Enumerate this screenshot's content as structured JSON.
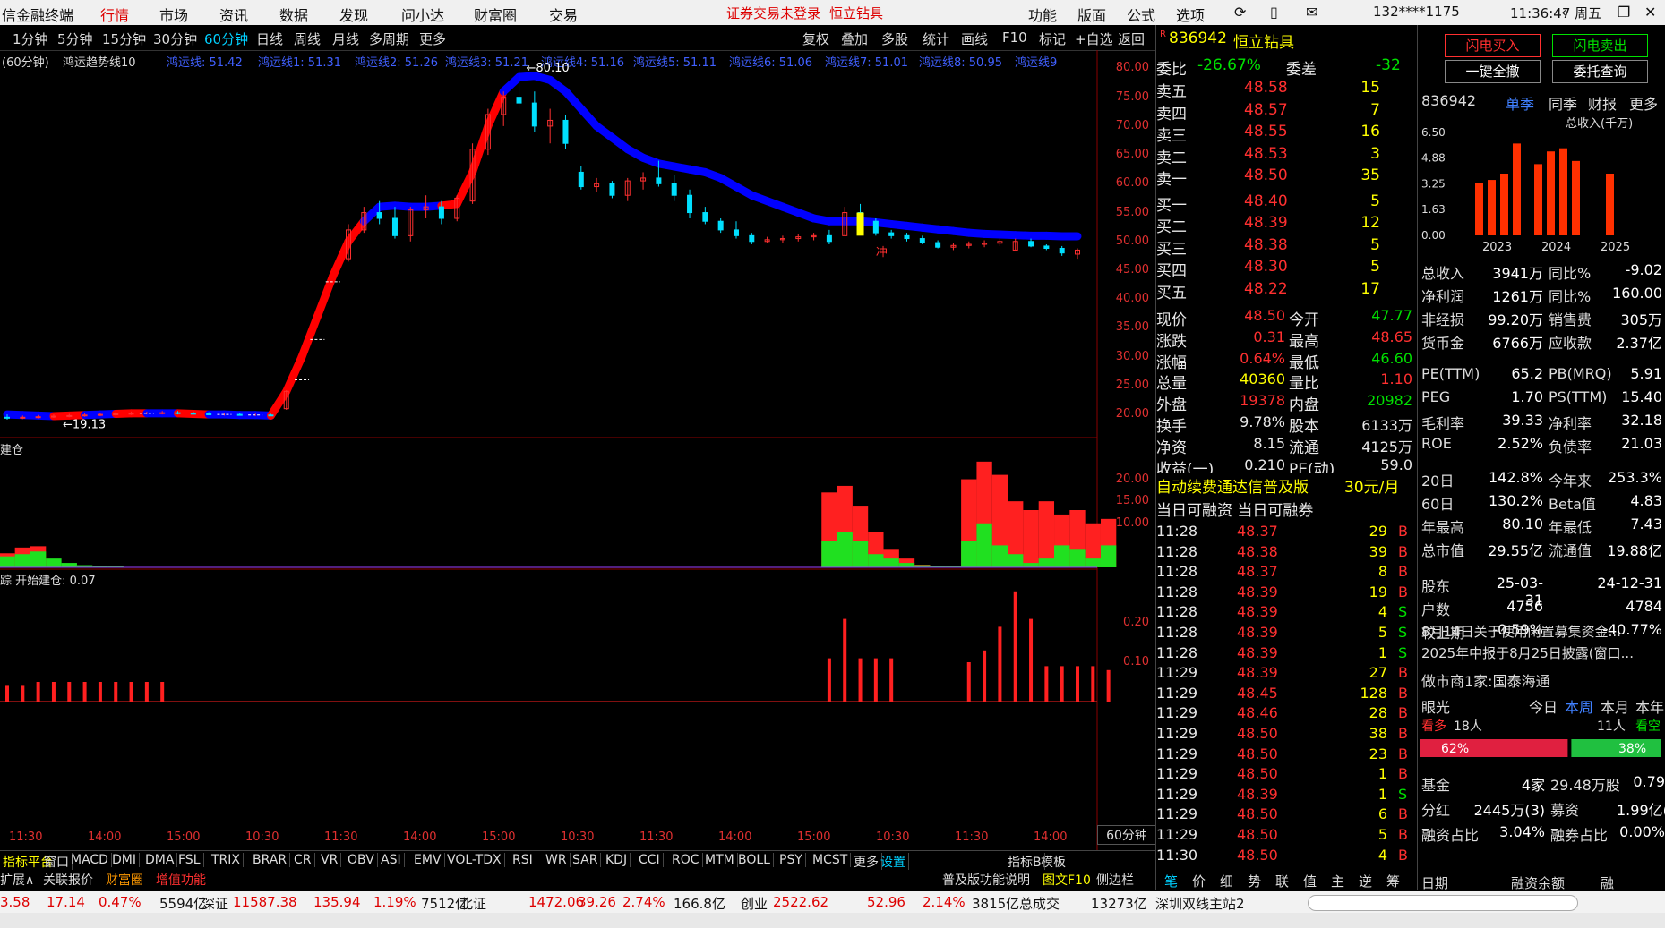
{
  "menubar": {
    "app": "信金融终端",
    "items": [
      "行情",
      "市场",
      "资讯",
      "数据",
      "发现",
      "问小达",
      "财富圈",
      "交易"
    ],
    "notice": "证券交易未登录",
    "stock_name": "恒立钻具",
    "right": [
      "功能",
      "版面",
      "公式",
      "选项"
    ],
    "account": "132****1175",
    "clock": "11:36:47 周五"
  },
  "timeframes": [
    "1分钟",
    "5分钟",
    "15分钟",
    "30分钟",
    "60分钟",
    "日线",
    "周线",
    "月线",
    "多周期",
    "更多"
  ],
  "toolbar": [
    "复权",
    "叠加",
    "多股",
    "统计",
    "画线",
    "F10",
    "标记",
    "+自选",
    "返回"
  ],
  "indicator_header": {
    "period": "(60分钟)",
    "name": "鸿运趋势线10",
    "lines": [
      "鸿运线: 51.42",
      "鸿运线1: 51.31",
      "鸿运线2: 51.26",
      "鸿运线3: 51.21",
      "鸿运线4: 51.16",
      "鸿运线5: 51.11",
      "鸿运线6: 51.06",
      "鸿运线7: 51.01",
      "鸿运线8: 50.95",
      "鸿运线9"
    ]
  },
  "price_axis": [
    "80.00",
    "75.00",
    "70.00",
    "65.00",
    "60.00",
    "55.00",
    "50.00",
    "45.00",
    "40.00",
    "35.00",
    "30.00",
    "25.00",
    "20.00"
  ],
  "price_markers": {
    "high": "80.10",
    "low": "19.13",
    "label": "冲"
  },
  "panel2": {
    "label": "建仓",
    "axis": [
      "20.00",
      "15.00",
      "10.00"
    ]
  },
  "panel3": {
    "label": "踪",
    "extra": "开始建仓: 0.07",
    "axis": [
      "0.20",
      "0.10"
    ]
  },
  "time_axis": [
    "11:30",
    "14:00",
    "15:00",
    "10:30",
    "11:30",
    "14:00",
    "15:00",
    "10:30",
    "11:30",
    "14:00",
    "15:00",
    "10:30",
    "11:30",
    "14:00"
  ],
  "period_badge": "60分钟",
  "indicator_tabs": [
    "指标平台",
    "窗口",
    "MACD",
    "DMI",
    "DMA",
    "FSL",
    "TRIX",
    "BRAR",
    "CR",
    "VR",
    "OBV",
    "ASI",
    "EMV",
    "VOL-TDX",
    "RSI",
    "WR",
    "SAR",
    "KDJ",
    "CCI",
    "ROC",
    "MTM",
    "BOLL",
    "PSY",
    "MCST",
    "更多",
    "设置",
    "指标B",
    "模板"
  ],
  "bottom_tabs": [
    "扩展∧",
    "关联报价",
    "财富圈",
    "增值功能"
  ],
  "bottom_links": [
    "普及版功能说明",
    "图文F10",
    "侧边栏"
  ],
  "quote": {
    "code": "836942",
    "name": "恒立钻具",
    "wb_label": "委比",
    "wb": "-26.67%",
    "wc_label": "委差",
    "wc": "-32",
    "asks": [
      [
        "卖五",
        "48.58",
        "15"
      ],
      [
        "卖四",
        "48.57",
        "7"
      ],
      [
        "卖三",
        "48.55",
        "16"
      ],
      [
        "卖二",
        "48.53",
        "3"
      ],
      [
        "卖一",
        "48.50",
        "35"
      ]
    ],
    "bids": [
      [
        "买一",
        "48.40",
        "5"
      ],
      [
        "买二",
        "48.39",
        "12"
      ],
      [
        "买三",
        "48.38",
        "5"
      ],
      [
        "买四",
        "48.30",
        "5"
      ],
      [
        "买五",
        "48.22",
        "17"
      ]
    ],
    "stats": [
      [
        "现价",
        "48.50",
        "今开",
        "47.77"
      ],
      [
        "涨跌",
        "0.31",
        "最高",
        "48.65"
      ],
      [
        "涨幅",
        "0.64%",
        "最低",
        "46.60"
      ],
      [
        "总量",
        "40360",
        "量比",
        "1.10"
      ],
      [
        "外盘",
        "19378",
        "内盘",
        "20982"
      ],
      [
        "换手",
        "9.78%",
        "股本",
        "6133万"
      ],
      [
        "净资",
        "8.15",
        "流通",
        "4125万"
      ],
      [
        "收益(一)",
        "0.210",
        "PE(动)",
        "59.0"
      ]
    ],
    "promo": "自动续费通达信普及版",
    "promo_price": "30元/月",
    "margin": "当日可融资 当日可融券",
    "ticks": [
      [
        "11:28",
        "48.37",
        "29",
        "B"
      ],
      [
        "11:28",
        "48.38",
        "39",
        "B"
      ],
      [
        "11:28",
        "48.37",
        "8",
        "B"
      ],
      [
        "11:28",
        "48.39",
        "19",
        "B"
      ],
      [
        "11:28",
        "48.39",
        "4",
        "S"
      ],
      [
        "11:28",
        "48.39",
        "5",
        "S"
      ],
      [
        "11:28",
        "48.39",
        "1",
        "S"
      ],
      [
        "11:29",
        "48.39",
        "27",
        "B"
      ],
      [
        "11:29",
        "48.45",
        "128",
        "B"
      ],
      [
        "11:29",
        "48.46",
        "28",
        "B"
      ],
      [
        "11:29",
        "48.50",
        "38",
        "B"
      ],
      [
        "11:29",
        "48.50",
        "23",
        "B"
      ],
      [
        "11:29",
        "48.50",
        "1",
        "B"
      ],
      [
        "11:29",
        "48.39",
        "1",
        "S"
      ],
      [
        "11:29",
        "48.50",
        "6",
        "B"
      ],
      [
        "11:29",
        "48.50",
        "5",
        "B"
      ],
      [
        "11:30",
        "48.50",
        "4",
        "B"
      ]
    ],
    "side_tabs": [
      "笔",
      "价",
      "细",
      "势",
      "联",
      "值",
      "主",
      "逆",
      "筹"
    ]
  },
  "fin": {
    "btn_buy": "闪电买入",
    "btn_sell": "闪电卖出",
    "btn_cancel": "一键全撤",
    "btn_query": "委托查询",
    "code": "836942",
    "tabs": [
      "单季",
      "同季",
      "财报",
      "更多"
    ],
    "chart_title": "总收入(千万)",
    "yaxis": [
      "6.50",
      "4.88",
      "3.25",
      "1.63",
      "0.00"
    ],
    "years": [
      "2023",
      "2024",
      "2025"
    ],
    "rows1": [
      [
        "总收入",
        "3941万",
        "同比%",
        "-9.02"
      ],
      [
        "净利润",
        "1261万",
        "同比%",
        "160.00"
      ],
      [
        "非经损",
        "99.20万",
        "销售费",
        "305万"
      ],
      [
        "货币金",
        "6766万",
        "应收款",
        "2.37亿"
      ]
    ],
    "rows2": [
      [
        "PE(TTM)",
        "65.2",
        "PB(MRQ)",
        "5.91"
      ],
      [
        "PEG",
        "1.70",
        "PS(TTM)",
        "15.40"
      ],
      [
        "毛利率",
        "39.33",
        "净利率",
        "32.18"
      ],
      [
        "ROE",
        "2.52%",
        "负债率",
        "21.03"
      ]
    ],
    "rows3": [
      [
        "20日",
        "142.8%",
        "今年来",
        "253.3%"
      ],
      [
        "60日",
        "130.2%",
        "Beta值",
        "4.83"
      ],
      [
        "年最高",
        "80.10",
        "年最低",
        "7.43"
      ],
      [
        "总市值",
        "29.55亿",
        "流通值",
        "19.88亿"
      ]
    ],
    "rows4": [
      [
        "股东",
        "25-03-31",
        "24-12-31"
      ],
      [
        "户数",
        "4756",
        "4784"
      ],
      [
        "较上期",
        "-0.59%",
        "-40.77%"
      ]
    ],
    "news": [
      "8月14日关于使用闲置募集资金...",
      "2025年中报于8月25日披露(窗口..."
    ],
    "market_maker": "做市商1家:国泰海通",
    "eye": "眼光",
    "periods": [
      "今日",
      "本周",
      "本月",
      "本年"
    ],
    "bull": "看多",
    "bull_n": "18人",
    "bear": "看空",
    "bear_n": "11人",
    "bull_pct": "62%",
    "bear_pct": "38%",
    "rows5": [
      [
        "基金",
        "4家",
        "29.48万股",
        "0.79"
      ],
      [
        "分红",
        "2445万(3)",
        "募资",
        "1.99亿(1"
      ],
      [
        "融资占比",
        "3.04%",
        "融券占比",
        "0.00%"
      ]
    ],
    "footer": [
      "日期",
      "融资余额",
      "融"
    ]
  },
  "status": {
    "items": [
      "3.58",
      "17.14",
      "0.47%",
      "5594亿",
      "深证",
      "11587.38",
      "135.94",
      "1.19%",
      "7512亿",
      "北证",
      "1472.06",
      "39.26",
      "2.74%",
      "166.8亿",
      "创业",
      "2522.62",
      "52.96",
      "2.14%",
      "3815亿",
      "总成交",
      "13273亿",
      "深圳双线主站2"
    ]
  },
  "colors": {
    "up": "#ff3030",
    "down": "#00e000",
    "trend_up": "#ff0000",
    "trend_down": "#0000ff",
    "bg": "#000000"
  },
  "chart_data": {
    "type": "candlestick",
    "ylim": [
      18,
      81
    ],
    "candles": [
      {
        "o": 19.5,
        "h": 20.0,
        "l": 19.1,
        "c": 19.4
      },
      {
        "o": 19.4,
        "h": 19.8,
        "l": 19.2,
        "c": 19.5
      },
      {
        "o": 19.5,
        "h": 19.9,
        "l": 19.3,
        "c": 19.6
      },
      {
        "o": 19.6,
        "h": 20.0,
        "l": 19.4,
        "c": 19.7
      },
      {
        "o": 19.7,
        "h": 20.1,
        "l": 19.5,
        "c": 19.8
      },
      {
        "o": 19.8,
        "h": 20.2,
        "l": 19.6,
        "c": 19.9
      },
      {
        "o": 19.9,
        "h": 20.3,
        "l": 19.7,
        "c": 20.0
      },
      {
        "o": 20.0,
        "h": 20.4,
        "l": 19.8,
        "c": 20.1
      },
      {
        "o": 20.1,
        "h": 20.5,
        "l": 19.9,
        "c": 20.2
      },
      {
        "o": 20.2,
        "h": 20.5,
        "l": 20.0,
        "c": 20.2
      },
      {
        "o": 20.2,
        "h": 20.6,
        "l": 20.0,
        "c": 20.3
      },
      {
        "o": 20.3,
        "h": 20.6,
        "l": 20.0,
        "c": 20.2
      },
      {
        "o": 20.2,
        "h": 20.5,
        "l": 20.0,
        "c": 20.1
      },
      {
        "o": 20.1,
        "h": 20.4,
        "l": 19.9,
        "c": 20.0
      },
      {
        "o": 20.0,
        "h": 20.3,
        "l": 19.8,
        "c": 20.0
      },
      {
        "o": 20.0,
        "h": 20.3,
        "l": 19.8,
        "c": 19.9
      },
      {
        "o": 19.9,
        "h": 20.2,
        "l": 19.7,
        "c": 19.9
      },
      {
        "o": 19.9,
        "h": 20.1,
        "l": 19.7,
        "c": 19.8
      },
      {
        "o": 21.0,
        "h": 24.2,
        "l": 20.8,
        "c": 24.0
      },
      {
        "o": 26.0,
        "h": 26.0,
        "l": 26.0,
        "c": 26.0
      },
      {
        "o": 33.0,
        "h": 33.0,
        "l": 33.0,
        "c": 33.0
      },
      {
        "o": 43.0,
        "h": 43.0,
        "l": 43.0,
        "c": 43.0
      },
      {
        "o": 47.0,
        "h": 53.0,
        "l": 46.5,
        "c": 52.0
      },
      {
        "o": 52.0,
        "h": 56.0,
        "l": 51.5,
        "c": 55.0
      },
      {
        "o": 55.0,
        "h": 57.0,
        "l": 53.0,
        "c": 54.0
      },
      {
        "o": 54.0,
        "h": 56.0,
        "l": 50.5,
        "c": 51.0
      },
      {
        "o": 51.0,
        "h": 56.0,
        "l": 50.0,
        "c": 55.5
      },
      {
        "o": 55.5,
        "h": 58.0,
        "l": 54.0,
        "c": 56.0
      },
      {
        "o": 56.0,
        "h": 57.0,
        "l": 53.0,
        "c": 54.0
      },
      {
        "o": 54.0,
        "h": 58.0,
        "l": 53.5,
        "c": 57.5
      },
      {
        "o": 57.0,
        "h": 67.0,
        "l": 56.5,
        "c": 66.0
      },
      {
        "o": 66.0,
        "h": 73.0,
        "l": 65.0,
        "c": 72.0
      },
      {
        "o": 72.0,
        "h": 76.0,
        "l": 70.0,
        "c": 75.0
      },
      {
        "o": 75.0,
        "h": 80.1,
        "l": 73.0,
        "c": 74.0
      },
      {
        "o": 74.0,
        "h": 76.0,
        "l": 69.0,
        "c": 70.0
      },
      {
        "o": 70.0,
        "h": 73.0,
        "l": 67.0,
        "c": 71.0
      },
      {
        "o": 71.0,
        "h": 72.0,
        "l": 66.0,
        "c": 67.0
      },
      {
        "o": 62.0,
        "h": 63.0,
        "l": 59.0,
        "c": 59.5
      },
      {
        "o": 59.5,
        "h": 61.0,
        "l": 58.5,
        "c": 60.0
      },
      {
        "o": 60.0,
        "h": 60.5,
        "l": 57.5,
        "c": 58.0
      },
      {
        "o": 58.0,
        "h": 61.0,
        "l": 57.0,
        "c": 60.5
      },
      {
        "o": 60.5,
        "h": 62.0,
        "l": 59.0,
        "c": 61.0
      },
      {
        "o": 61.0,
        "h": 64.0,
        "l": 59.5,
        "c": 60.0
      },
      {
        "o": 60.0,
        "h": 61.5,
        "l": 57.0,
        "c": 58.0
      },
      {
        "o": 58.0,
        "h": 59.0,
        "l": 54.0,
        "c": 55.0
      },
      {
        "o": 55.0,
        "h": 56.0,
        "l": 53.0,
        "c": 53.5
      },
      {
        "o": 53.5,
        "h": 54.0,
        "l": 51.5,
        "c": 52.0
      },
      {
        "o": 52.0,
        "h": 53.5,
        "l": 50.5,
        "c": 51.0
      },
      {
        "o": 51.0,
        "h": 51.5,
        "l": 49.5,
        "c": 50.0
      },
      {
        "o": 50.0,
        "h": 50.8,
        "l": 49.8,
        "c": 50.3
      },
      {
        "o": 50.3,
        "h": 51.0,
        "l": 49.7,
        "c": 50.5
      },
      {
        "o": 50.5,
        "h": 51.3,
        "l": 50.0,
        "c": 50.8
      },
      {
        "o": 50.8,
        "h": 51.5,
        "l": 50.2,
        "c": 51.0
      },
      {
        "o": 51.0,
        "h": 52.0,
        "l": 49.5,
        "c": 50.0
      },
      {
        "o": 51.0,
        "h": 56.0,
        "l": 51.0,
        "c": 55.0
      },
      {
        "o": 55.0,
        "h": 56.5,
        "l": 53.0,
        "c": 53.5
      },
      {
        "o": 53.5,
        "h": 54.0,
        "l": 51.0,
        "c": 51.5
      },
      {
        "o": 51.5,
        "h": 52.0,
        "l": 50.5,
        "c": 51.0
      },
      {
        "o": 51.0,
        "h": 51.5,
        "l": 50.0,
        "c": 50.5
      },
      {
        "o": 50.5,
        "h": 51.0,
        "l": 49.5,
        "c": 49.8
      },
      {
        "o": 49.8,
        "h": 50.2,
        "l": 48.8,
        "c": 49.0
      },
      {
        "o": 49.0,
        "h": 49.8,
        "l": 48.5,
        "c": 49.3
      },
      {
        "o": 49.3,
        "h": 50.0,
        "l": 48.8,
        "c": 49.5
      },
      {
        "o": 49.5,
        "h": 50.2,
        "l": 49.0,
        "c": 49.7
      },
      {
        "o": 49.7,
        "h": 50.5,
        "l": 49.2,
        "c": 50.0
      },
      {
        "o": 48.5,
        "h": 50.5,
        "l": 48.5,
        "c": 50.0
      },
      {
        "o": 50.0,
        "h": 50.5,
        "l": 49.0,
        "c": 49.2
      },
      {
        "o": 49.2,
        "h": 49.5,
        "l": 48.5,
        "c": 48.8
      },
      {
        "o": 48.8,
        "h": 49.2,
        "l": 47.5,
        "c": 48.0
      },
      {
        "o": 47.8,
        "h": 48.8,
        "l": 47.0,
        "c": 48.5
      }
    ],
    "trend": [
      20.0,
      19.9,
      19.8,
      19.7,
      19.8,
      19.9,
      20.0,
      20.1,
      20.2,
      20.2,
      20.2,
      20.2,
      20.1,
      20.0,
      20.0,
      19.9,
      19.9,
      19.8,
      24.0,
      30.0,
      37.0,
      44.0,
      50.0,
      53.5,
      56.0,
      56.2,
      56.0,
      56.0,
      56.2,
      56.5,
      62.0,
      70.0,
      76.0,
      78.5,
      78.7,
      78.0,
      76.0,
      73.0,
      70.0,
      68.0,
      66.0,
      64.5,
      63.5,
      63.0,
      62.5,
      62.0,
      61.0,
      59.5,
      58.0,
      57.0,
      56.0,
      55.0,
      54.0,
      53.5,
      53.5,
      53.5,
      53.3,
      53.0,
      52.7,
      52.4,
      52.1,
      51.8,
      51.5,
      51.3,
      51.2,
      51.1,
      51.0,
      51.0,
      50.9,
      50.9,
      50.8
    ],
    "trend_dir": [
      "d",
      "d",
      "d",
      "d",
      "u",
      "u",
      "d",
      "d",
      "u",
      "u",
      "d",
      "d",
      "u",
      "u",
      "d",
      "d",
      "d",
      "d",
      "u",
      "u",
      "u",
      "u",
      "u",
      "u",
      "d",
      "d",
      "d",
      "d",
      "d",
      "u",
      "u",
      "u",
      "u",
      "d",
      "d",
      "d",
      "d",
      "d",
      "d",
      "d",
      "d",
      "d",
      "d",
      "d",
      "d",
      "d",
      "d",
      "d",
      "d",
      "d",
      "d",
      "d",
      "d",
      "d",
      "d",
      "d",
      "d",
      "d",
      "d",
      "d",
      "d",
      "d",
      "d",
      "d",
      "d",
      "d",
      "d",
      "d",
      "d",
      "d",
      "d"
    ],
    "vol_red": [
      3.2,
      4.5,
      4.8,
      0,
      0,
      0,
      0,
      0,
      0,
      0,
      0,
      0,
      0,
      0,
      0,
      0,
      0,
      0,
      0,
      0,
      0,
      0,
      0,
      0,
      0,
      0,
      0,
      0,
      0,
      0,
      0,
      0,
      0,
      0,
      0,
      0,
      0,
      0,
      0,
      0,
      0,
      0,
      0,
      0,
      0,
      0,
      0,
      0,
      0,
      0,
      0,
      0,
      0,
      0,
      0,
      0,
      0,
      0,
      0,
      0,
      0,
      0,
      0,
      0,
      0,
      0,
      0,
      0,
      0,
      0
    ],
    "vol_green": [
      2.5,
      3.0,
      3.6,
      2.0,
      1.0,
      0.5,
      0.3,
      0.2,
      0.1,
      0.1,
      0.1,
      0.1,
      0.1,
      0.1,
      0.1,
      0.1,
      0.1,
      0.1,
      0,
      0,
      0,
      0,
      0,
      0,
      0,
      0,
      0,
      0,
      0,
      0,
      0,
      0,
      0,
      0,
      0,
      0,
      0,
      0,
      0,
      0,
      0,
      0,
      0,
      0,
      0,
      0,
      0,
      0,
      0,
      0,
      0,
      0,
      0,
      0,
      0,
      0,
      0,
      0,
      0,
      0,
      0,
      0,
      0,
      0,
      0,
      0,
      0,
      0,
      0,
      0
    ],
    "vol2_red": [
      0,
      0,
      0,
      0,
      0,
      0,
      0,
      0,
      0,
      0,
      0,
      0,
      0,
      0,
      0,
      0,
      0,
      0,
      0,
      0,
      0,
      0,
      0,
      0,
      0,
      0,
      0,
      0,
      0,
      0,
      0,
      0,
      0,
      0,
      0,
      0,
      0,
      0,
      0,
      0,
      0,
      0,
      0,
      0,
      0,
      0,
      0,
      0,
      0,
      0,
      0,
      0,
      0,
      17,
      18.5,
      14,
      8,
      4,
      2,
      0.6,
      0.4,
      0.2,
      20,
      24,
      21,
      15,
      13,
      15,
      12,
      13,
      10,
      11
    ],
    "vol2_green": [
      0,
      0,
      0,
      0,
      0,
      0,
      0,
      0,
      0,
      0,
      0,
      0,
      0,
      0,
      0,
      0,
      0,
      0,
      0,
      0,
      0,
      0,
      0,
      0,
      0,
      0,
      0,
      0,
      0,
      0,
      0,
      0,
      0,
      0,
      0,
      0,
      0,
      0,
      0,
      0,
      0,
      0,
      0,
      0,
      0,
      0,
      0,
      0,
      0,
      0,
      0,
      0,
      0,
      6,
      8,
      6,
      3,
      2,
      1,
      0.5,
      0.3,
      0.2,
      6,
      10,
      5,
      3,
      1,
      2,
      5,
      4,
      2,
      5
    ],
    "bars3": [
      0.04,
      0.04,
      0.05,
      0.05,
      0.05,
      0.05,
      0.05,
      0.05,
      0.05,
      0.05,
      0.05,
      0,
      0,
      0,
      0,
      0,
      0,
      0,
      0,
      0,
      0,
      0,
      0,
      0,
      0,
      0,
      0,
      0,
      0,
      0,
      0,
      0,
      0,
      0,
      0,
      0,
      0,
      0,
      0,
      0,
      0,
      0,
      0,
      0,
      0,
      0,
      0,
      0,
      0,
      0,
      0,
      0,
      0,
      0.11,
      0.21,
      0.11,
      0.11,
      0.11,
      0,
      0,
      0,
      0,
      0.1,
      0.13,
      0.19,
      0.28,
      0.21,
      0.09,
      0.09,
      0.09,
      0.09,
      0.08
    ]
  }
}
